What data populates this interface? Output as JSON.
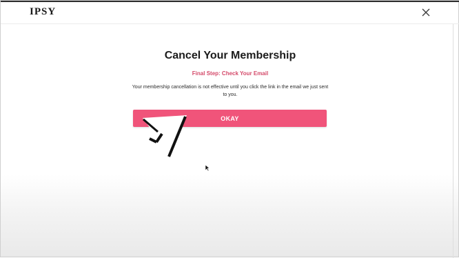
{
  "header": {
    "logo": "IPSY"
  },
  "modal": {
    "title": "Cancel Your Membership",
    "subtitle": "Final Step: Check Your Email",
    "body": "Your membership cancellation is not effective until you click the link in the email we just sent to you.",
    "okay_button": "OKAY"
  },
  "icons": {
    "close": "close-icon",
    "large_cursor": "large-pointer-overlay-icon",
    "mouse_cursor": "mouse-cursor-icon"
  },
  "colors": {
    "accent": "#f0547a",
    "subtitle": "#d44a6a",
    "text": "#1b1b1b"
  }
}
